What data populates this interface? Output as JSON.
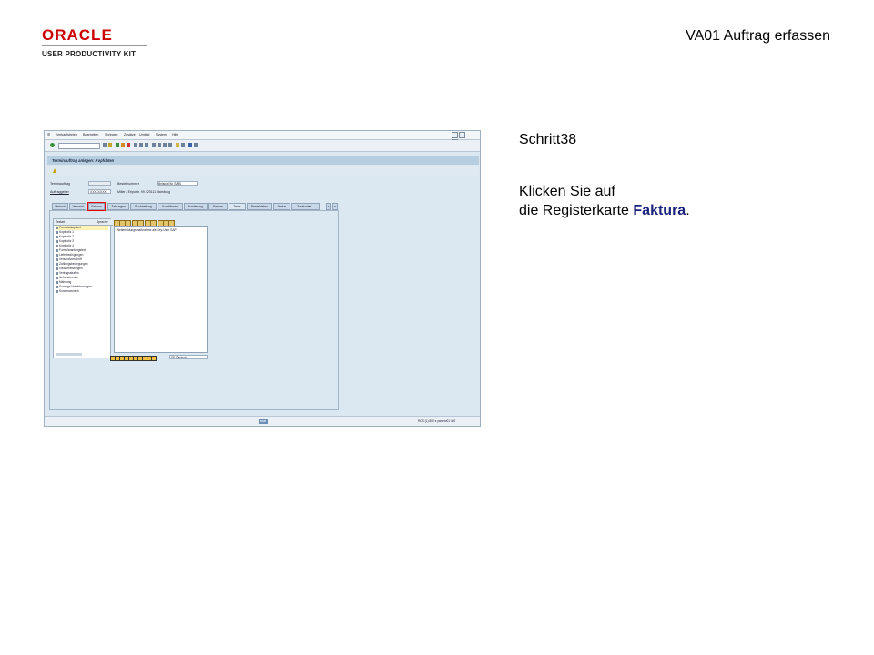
{
  "header": {
    "logo_brand": "ORACLE",
    "logo_sub": "USER PRODUCTIVITY KIT",
    "doc_title": "VA01 Auftrag erfassen"
  },
  "instructions": {
    "step_label": "Schritt38",
    "line1": "Klicken Sie auf",
    "line2_prefix": "die Registerkarte ",
    "keyword": "Faktura",
    "line2_suffix": "."
  },
  "sap": {
    "menu": [
      "Verkaufsbeleg",
      "Bearbeiten",
      "Springen",
      "Zusätze",
      "Umfeld",
      "System",
      "Hilfe"
    ],
    "title": "Terminauftrag anlegen: Kopfdaten",
    "fields": {
      "terminauftrag_label": "Terminauftrag",
      "auftraggeber_label": "Auftraggeber",
      "auftraggeber_value": "XXXXXXXX",
      "bestellnummer_label": "Bestellnummer",
      "bestellnummer_value": "Beispiel für SAIB",
      "address_value": "Miller / Erlpostr. 99 / 20111 Hamburg"
    },
    "tabs": [
      "Verkauf",
      "Versand",
      "Faktura",
      "Zahlungen",
      "Buchhaltung",
      "Konditionen",
      "Kontierung",
      "Partner",
      "Texte",
      "Bestelldaten",
      "Status",
      "Zusatzdate..."
    ],
    "active_tab": "Texte",
    "highlight_tab": "Faktura",
    "tree_headers": [
      "Textart",
      "Sprache"
    ],
    "tree_items": [
      "Formularkopftext",
      "Kopfnotiz 1",
      "Kopfnotiz 2",
      "Kopfnotiz 3",
      "Kopfnotiz 4",
      "Formularanfangstext",
      "Lieferbedingungen",
      "Versandvorschrift",
      "Zahlungsbedingungen",
      "Gewährleistungen",
      "Vertragsstrafen",
      "Nebenabreden",
      "Mahnung",
      "Sonstige Vereinbarungen",
      "Kundenwunsch"
    ],
    "editor_text": "Weiterbildungsmaßnahme als Key-User SAP",
    "language_value": "DE Deutsch",
    "status_info": "RCS (1) 800 ▾  pcmerv01  INS"
  }
}
